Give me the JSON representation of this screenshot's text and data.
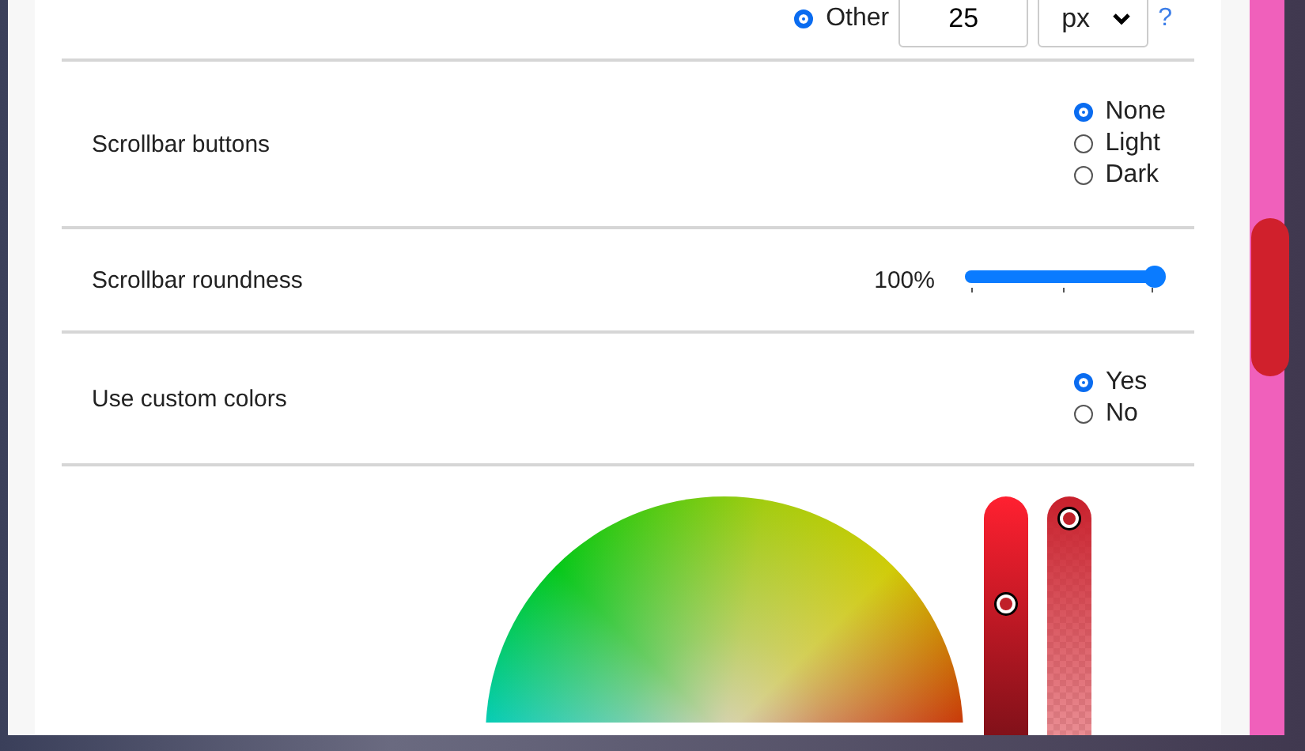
{
  "size_row": {
    "option": {
      "label": "Other",
      "selected": true
    },
    "value": "25",
    "unit": "px",
    "help": "?"
  },
  "settings": [
    {
      "kind": "radio",
      "label": "Scrollbar buttons",
      "options": [
        {
          "label": "None",
          "selected": true
        },
        {
          "label": "Light",
          "selected": false
        },
        {
          "label": "Dark",
          "selected": false
        }
      ]
    },
    {
      "kind": "slider",
      "label": "Scrollbar roundness",
      "reading": "100%",
      "level": 1
    },
    {
      "kind": "radio",
      "label": "Use custom colors",
      "options": [
        {
          "label": "Yes",
          "selected": true
        },
        {
          "label": "No",
          "selected": false
        }
      ]
    }
  ],
  "color_picker": {
    "lightness": {
      "level": 0.52
    },
    "opacity": {
      "level": 1
    }
  }
}
